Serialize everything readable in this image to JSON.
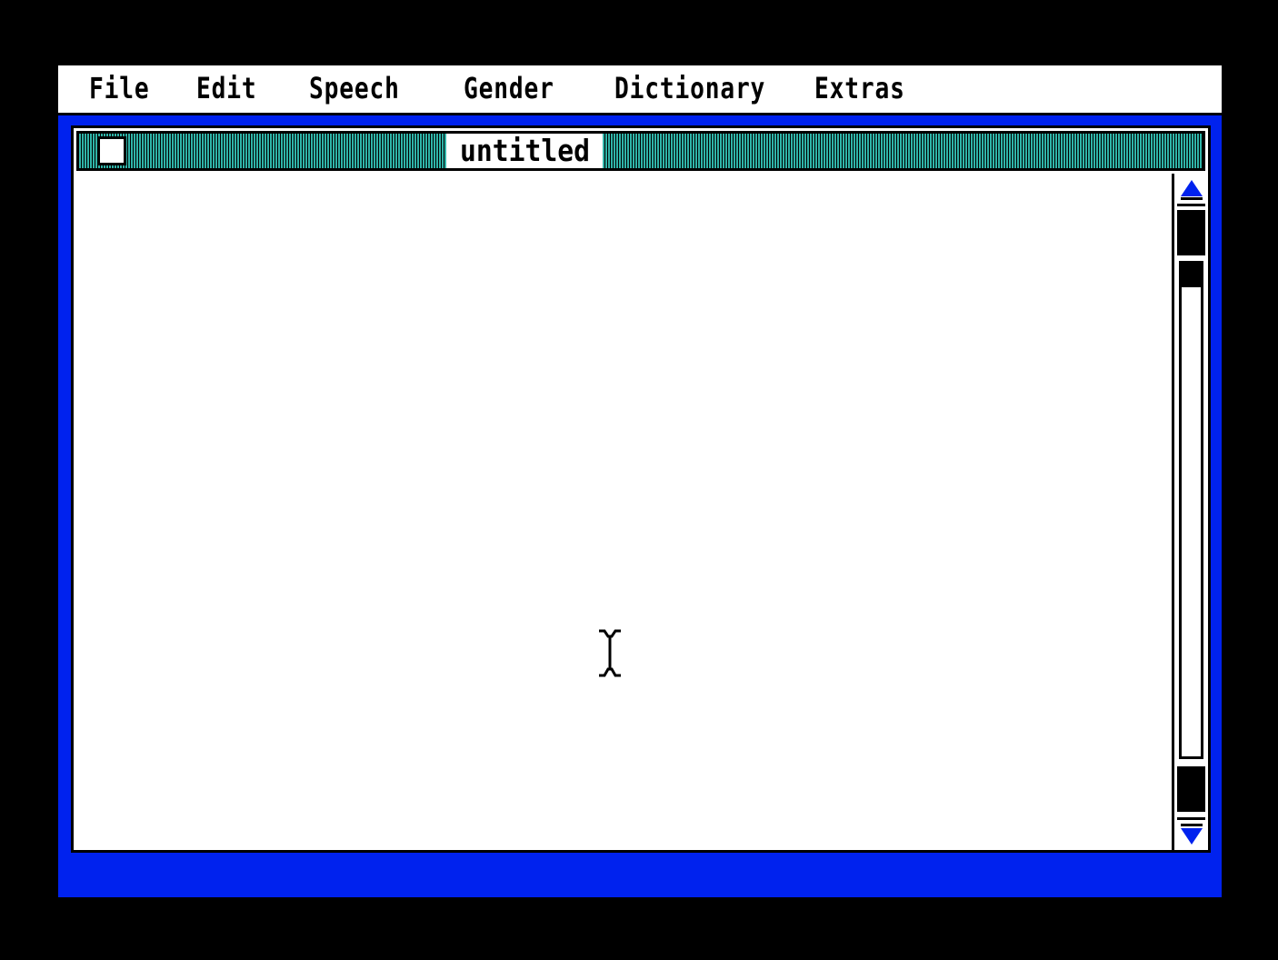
{
  "menubar": {
    "items": [
      {
        "label": "File"
      },
      {
        "label": "Edit"
      },
      {
        "label": "Speech"
      },
      {
        "label": "Gender"
      },
      {
        "label": "Dictionary"
      },
      {
        "label": "Extras"
      }
    ]
  },
  "window": {
    "title": "untitled",
    "content_text": ""
  },
  "icons": {
    "close": "close-box-icon",
    "scroll_up": "up-arrow-icon",
    "scroll_down": "down-arrow-icon",
    "cursor": "text-cursor-icon"
  },
  "colors": {
    "desktop": "#0022ee",
    "titlebar_stripes": "#2fb4a8",
    "arrows": "#0022ee"
  }
}
